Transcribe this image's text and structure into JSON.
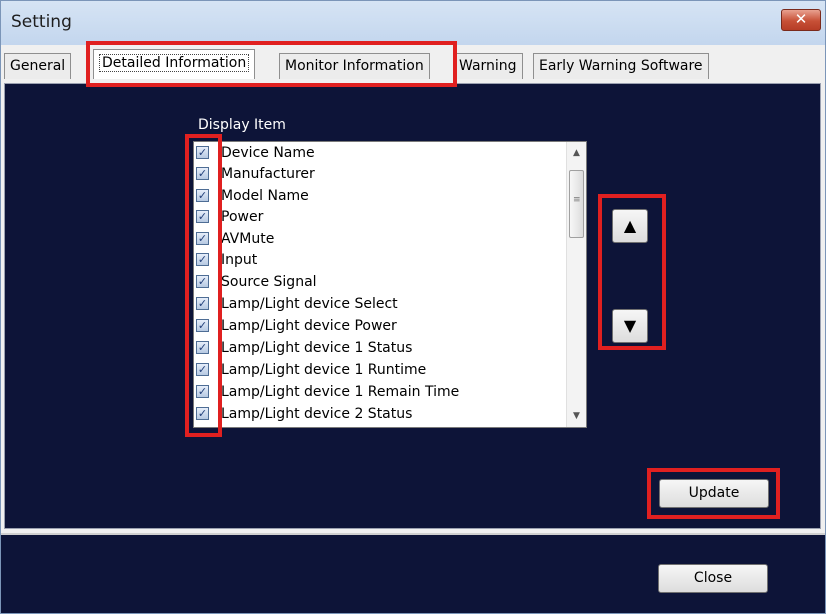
{
  "window": {
    "title": "Setting",
    "close_glyph": "✕"
  },
  "tabs": [
    {
      "label": "General"
    },
    {
      "label": "Detailed Information"
    },
    {
      "label": "Monitor Information"
    },
    {
      "label": "Warning"
    },
    {
      "label": "Early Warning Software"
    }
  ],
  "active_tab": "Detailed Information",
  "display_item": {
    "label": "Display Item",
    "items": [
      {
        "label": "Device Name",
        "checked": true
      },
      {
        "label": "Manufacturer",
        "checked": true
      },
      {
        "label": "Model Name",
        "checked": true
      },
      {
        "label": "Power",
        "checked": true
      },
      {
        "label": "AVMute",
        "checked": true
      },
      {
        "label": "Input",
        "checked": true
      },
      {
        "label": "Source Signal",
        "checked": true
      },
      {
        "label": "Lamp/Light device Select",
        "checked": true
      },
      {
        "label": "Lamp/Light device Power",
        "checked": true
      },
      {
        "label": "Lamp/Light device 1 Status",
        "checked": true
      },
      {
        "label": "Lamp/Light device 1 Runtime",
        "checked": true
      },
      {
        "label": "Lamp/Light device 1 Remain Time",
        "checked": true
      },
      {
        "label": "Lamp/Light device 2 Status",
        "checked": true
      }
    ]
  },
  "buttons": {
    "move_up_glyph": "▲",
    "move_down_glyph": "▼",
    "update": "Update",
    "close": "Close"
  },
  "icons": {
    "checkmark": "✓",
    "scroll_up": "▲",
    "scroll_down": "▼",
    "grip": "≡"
  },
  "colors": {
    "panel_background": "#0d1438",
    "highlight_box": "#e02020",
    "window_close": "#c75037"
  }
}
